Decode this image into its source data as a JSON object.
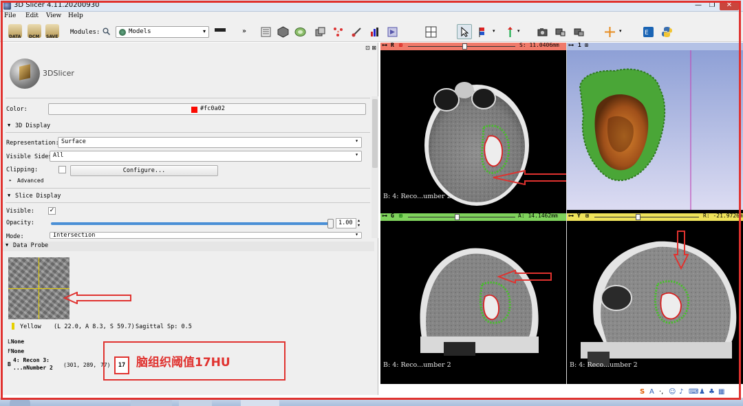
{
  "window": {
    "title": "3D Slicer 4.11.20200930",
    "min": "—",
    "max": "❐",
    "close": "✕"
  },
  "menu": {
    "file": "File",
    "edit": "Edit",
    "view": "View",
    "help": "Help"
  },
  "toolbar": {
    "data_label": "DATA",
    "dcm_label": "DCM",
    "save_label": "SAVE",
    "modules_label": "Modules:",
    "module_selected": "Models",
    "more": "»"
  },
  "left_panel": {
    "logo_text": "3DSlicer",
    "color_label": "Color:",
    "color_value": "#fc0a02",
    "color_hex": "#fc0a02",
    "sections": {
      "display3d": "3D Display",
      "slice_display": "Slice Display",
      "data_probe": "Data Probe"
    },
    "representation_label": "Representation:",
    "representation_value": "Surface",
    "visible_sides_label": "Visible Sides:",
    "visible_sides_value": "All",
    "clipping_label": "Clipping:",
    "configure_button": "Configure...",
    "advanced_label": "Advanced",
    "visible_label": "Visible:",
    "visible_check": "✓",
    "opacity_label": "Opacity:",
    "opacity_value": "1.00",
    "opacity_fraction": 1.0,
    "mode_label": "Mode:",
    "mode_value": "Intersection"
  },
  "data_probe": {
    "view_name": "Yellow",
    "coords": "(L 22.0, A 8.3, S 59.7)",
    "spacing": "Sagittal Sp: 0.5",
    "layer_L_prefix": "L",
    "layer_L": "None",
    "layer_F_prefix": "F",
    "layer_F": "None",
    "layer_B_prefix": "B",
    "layer_B_name1": "4: Recon 3:",
    "layer_B_name2": "...nNumber 2",
    "layer_B_ijk": "(301, 289,",
    "layer_B_ijk_end": "77)",
    "layer_B_value": "17"
  },
  "annotation": {
    "callout": "脑组织阈值17HU"
  },
  "views": {
    "red": {
      "letter": "R",
      "offset": "S: 11.0406mm",
      "label": "B: 4: Reco...umber 2",
      "slider": 0.53,
      "color": "#f07a6a"
    },
    "threed": {
      "letter": "1",
      "color": "#b4c2e6"
    },
    "green": {
      "letter": "G",
      "offset": "A: 14.1462mm",
      "label": "B: 4: Reco...umber 2",
      "slider": 0.46,
      "color": "#7fd35c"
    },
    "yellow": {
      "letter": "Y",
      "offset": "R: -21.9726m",
      "label": "B: 4: Reco...umber 2",
      "slider": 0.42,
      "color": "#efe35b"
    }
  }
}
